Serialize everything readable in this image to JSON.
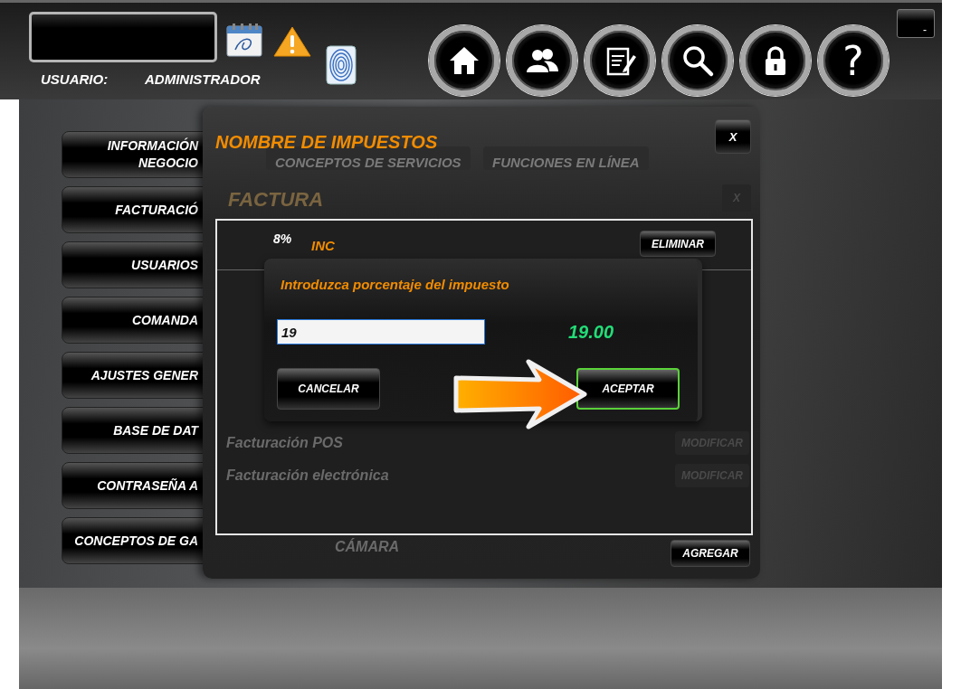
{
  "header": {
    "user_label": "USUARIO:",
    "user_name": "ADMINISTRADOR",
    "minimize": "-",
    "nav_buttons": [
      {
        "kind": "home"
      },
      {
        "kind": "users"
      },
      {
        "kind": "notes"
      },
      {
        "kind": "search"
      },
      {
        "kind": "lock"
      }
    ],
    "help_button": "?"
  },
  "sidebar": {
    "items": [
      {
        "lines": [
          "INFORMACIÓN",
          "NEGOCIO"
        ]
      },
      {
        "lines": [
          "FACTURACIÓ"
        ]
      },
      {
        "lines": [
          "USUARIOS"
        ]
      },
      {
        "lines": [
          "COMANDA"
        ]
      },
      {
        "lines": [
          "AJUSTES GENER"
        ]
      },
      {
        "lines": [
          "BASE DE DAT"
        ]
      },
      {
        "lines": [
          "CONTRASEÑA A"
        ]
      },
      {
        "lines": [
          "CONCEPTOS DE GA"
        ]
      }
    ]
  },
  "background_window": {
    "tabs": [
      "CONCEPTOS DE SERVICIOS",
      "FUNCIONES EN LÍNEA"
    ],
    "section_title": "FACTURA",
    "close": "X",
    "rows": [
      {
        "label": "Facturación POS",
        "action": "MODIFICAR"
      },
      {
        "label": "Facturación electrónica",
        "action": "MODIFICAR"
      }
    ],
    "footer_tab": "CÁMARA"
  },
  "tax_window": {
    "title": "NOMBRE DE IMPUESTOS",
    "close": "X",
    "taxes": [
      {
        "rate": "8%",
        "name": "INC",
        "action": "ELIMINAR"
      }
    ],
    "add_button": "AGREGAR"
  },
  "prompt": {
    "label": "Introduzca porcentaje del impuesto",
    "value": "19",
    "preview": "19.00",
    "cancel": "CANCELAR",
    "accept": "ACEPTAR",
    "accept_highlighted": true
  }
}
